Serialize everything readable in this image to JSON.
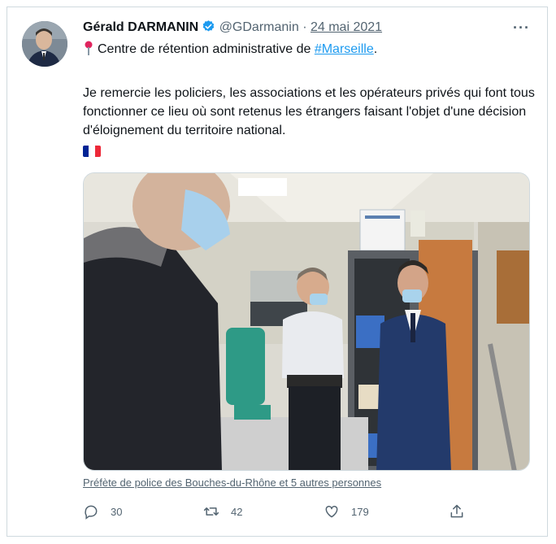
{
  "tweet": {
    "author_name": "Gérald DARMANIN",
    "handle": "@GDarmanin",
    "separator": "·",
    "date": "24 mai 2021",
    "more_label": "···",
    "location_prefix": "Centre de rétention administrative de ",
    "location_hashtag": "#Marseille",
    "location_suffix": ".",
    "body": "Je remercie les policiers, les associations et les opérateurs privés qui font tous fonctionner ce lieu où sont retenus les étrangers faisant l'objet d'une décision d'éloignement du territoire national.",
    "photo_tagline": "Préfète de police des Bouches-du-Rhône et 5 autres personnes",
    "flag_colors": [
      "#002395",
      "#ffffff",
      "#ed2939"
    ],
    "accent_color": "#1d9bf0",
    "icons": [
      "verified-badge-icon",
      "pin-icon",
      "more-icon",
      "reply-icon",
      "retweet-icon",
      "like-icon",
      "share-icon"
    ]
  },
  "actions": {
    "replies": "30",
    "retweets": "42",
    "likes": "179",
    "share": ""
  }
}
